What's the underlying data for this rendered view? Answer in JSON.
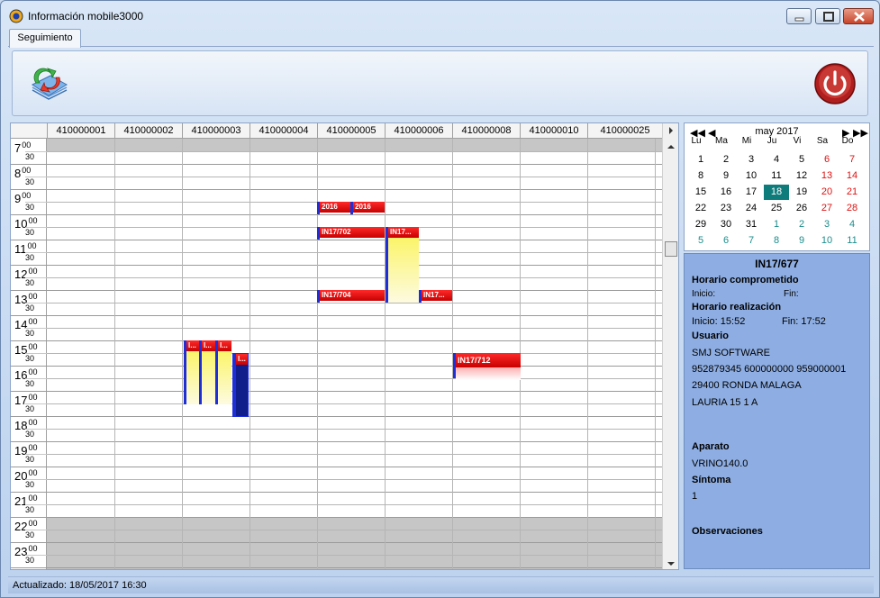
{
  "window": {
    "title": "Información mobile3000"
  },
  "tabs": [
    {
      "label": "Seguimiento"
    }
  ],
  "schedule": {
    "columns": [
      "410000001",
      "410000002",
      "410000003",
      "410000004",
      "410000005",
      "410000006",
      "410000008",
      "410000010",
      "410000025"
    ],
    "hours": [
      "7",
      "8",
      "9",
      "10",
      "11",
      "12",
      "13",
      "14",
      "15",
      "16",
      "17",
      "18",
      "19",
      "20",
      "21",
      "22",
      "23"
    ],
    "minute_top": "00",
    "minute_half": "30",
    "appointments": [
      {
        "label": "2016"
      },
      {
        "label": "2016"
      },
      {
        "label": "IN17/702"
      },
      {
        "label": "IN17..."
      },
      {
        "label": "IN17/704"
      },
      {
        "label": "IN17..."
      },
      {
        "label": "I..."
      },
      {
        "label": "I..."
      },
      {
        "label": "I..."
      },
      {
        "label": "I..."
      },
      {
        "label": "IN17/712"
      }
    ]
  },
  "calendar": {
    "month_label": "may 2017",
    "weekdays": [
      "Lu",
      "Ma",
      "Mi",
      "Ju",
      "Vi",
      "Sa",
      "Do"
    ],
    "days": [
      [
        "1",
        "2",
        "3",
        "4",
        "5",
        "6",
        "7"
      ],
      [
        "8",
        "9",
        "10",
        "11",
        "12",
        "13",
        "14"
      ],
      [
        "15",
        "16",
        "17",
        "18",
        "19",
        "20",
        "21"
      ],
      [
        "22",
        "23",
        "24",
        "25",
        "26",
        "27",
        "28"
      ],
      [
        "29",
        "30",
        "31",
        "1",
        "2",
        "3",
        "4"
      ],
      [
        "5",
        "6",
        "7",
        "8",
        "9",
        "10",
        "11"
      ]
    ],
    "selected_day": "18"
  },
  "detail": {
    "id": "IN17/677",
    "horario_comprometido_label": "Horario comprometido",
    "inicio_label": "Inicio:",
    "fin_label": "Fin:",
    "horario_realizacion_label": "Horario realización",
    "real_inicio": "Inicio: 15:52",
    "real_fin": "Fin:  17:52",
    "usuario_label": "Usuario",
    "usuario_nombre": "SMJ SOFTWARE",
    "usuario_telefonos": "952879345 600000000 959000001",
    "usuario_cp": "29400 RONDA MALAGA",
    "usuario_direccion": "LAURIA 15   1 A",
    "aparato_label": "Aparato",
    "aparato_valor": "VRINO140.0",
    "sintoma_label": "Síntoma",
    "sintoma_valor": "1",
    "observaciones_label": "Observaciones"
  },
  "status": {
    "text": "Actualizado: 18/05/2017 16:30"
  }
}
